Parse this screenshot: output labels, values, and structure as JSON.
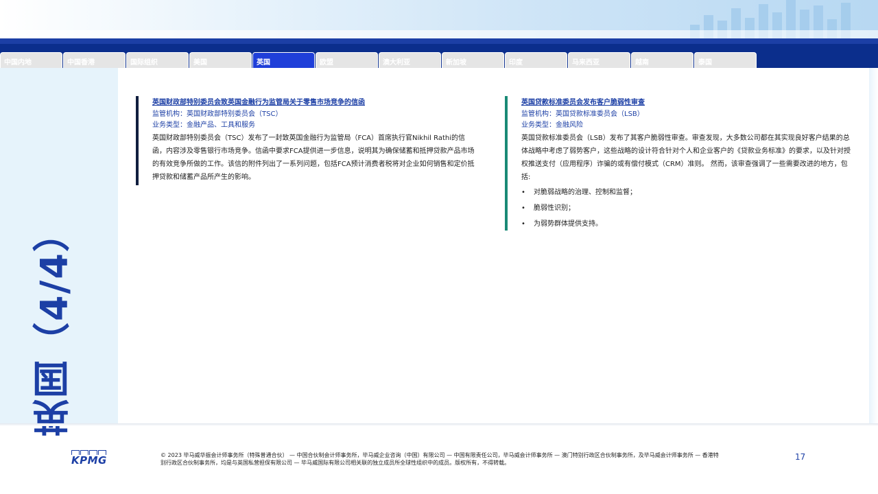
{
  "tabs": [
    {
      "label": "中国内地"
    },
    {
      "label": "中国香港"
    },
    {
      "label": "国际组织"
    },
    {
      "label": "美国"
    },
    {
      "label": "英国",
      "active": true
    },
    {
      "label": "欧盟"
    },
    {
      "label": "澳大利亚"
    },
    {
      "label": "新加坡"
    },
    {
      "label": "印度"
    },
    {
      "label": "马来西亚"
    },
    {
      "label": "越南"
    },
    {
      "label": "泰国"
    }
  ],
  "side_title": "英国（4/4）",
  "articles": [
    {
      "title": "英国财政部特别委员会致英国金融行为监管局关于零售市场竞争的信函",
      "regulator": "监管机构：英国财政部特别委员会（TSC）",
      "business_type": "业务类型：金融产品、工具和服务",
      "body": "英国财政部特别委员会（TSC）发布了一封致英国金融行为监管局（FCA）首席执行官Nikhil Rathi的信函，内容涉及零售银行市场竞争。信函中要求FCA提供进一步信息，说明其为确保储蓄和抵押贷款产品市场的有效竞争所做的工作。该信的附件列出了一系列问题，包括FCA预计消费者税将对企业如何销售和定价抵押贷款和储蓄产品所产生的影响。"
    },
    {
      "title": "英国贷款标准委员会发布客户脆弱性审查",
      "regulator": "监管机构：英国贷款标准委员会（LSB）",
      "business_type": "业务类型：金融风险",
      "body": "英国贷款标准委员会（LSB）发布了其客户脆弱性审查。审查发现，大多数公司都在其实现良好客户结果的总体战略中考虑了弱势客户，这些战略的设计符合针对个人和企业客户的《贷款业务标准》的要求，以及针对授权推送支付（应用程序）诈骗的或有偿付模式（CRM）准则。 然而，该审查强调了一些需要改进的地方，包括:",
      "bullets": [
        "对脆弱战略的治理、控制和监督；",
        "脆弱性识别；",
        "为弱势群体提供支持。"
      ]
    }
  ],
  "footer": {
    "logo_text": "KPMG",
    "copyright": "© 2023 毕马威华振会计师事务所（特殊普通合伙） — 中国合伙制会计师事务所，毕马威企业咨询（中国）有限公司 — 中国有限责任公司，毕马威会计师事务所 — 澳门特别行政区合伙制事务所，及毕马威会计师事务所 — 香港特别行政区合伙制事务所，均是与英国私营担保有限公司 — 毕马威国际有限公司相关联的独立成员所全球性组织中的成员。版权所有，不得转载。",
    "page_number": "17"
  },
  "colors": {
    "navy": "#0b2e8c",
    "brand_blue": "#1c3fa5",
    "active_tab": "#1f3fd9",
    "accent_teal": "#1a8a76",
    "accent_dark": "#111f3f"
  }
}
